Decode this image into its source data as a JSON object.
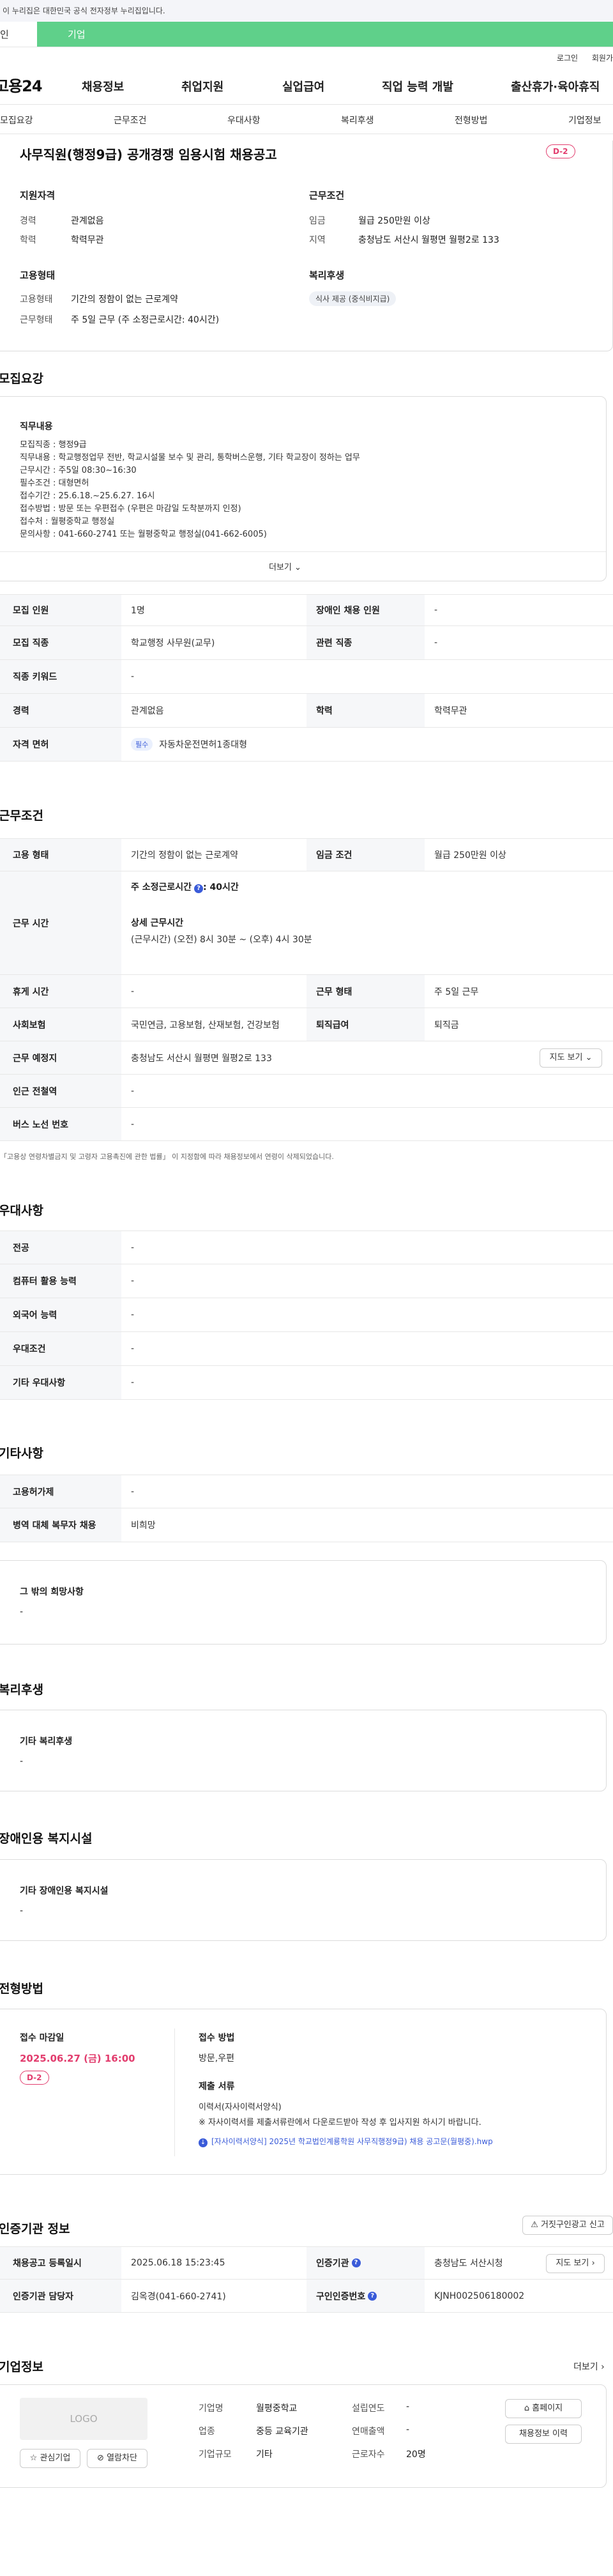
{
  "gov_notice": "이 누리집은 대한민국 공식 전자정부 누리집입니다.",
  "type_tabs": {
    "individual": "인",
    "corporate": "기업"
  },
  "util": {
    "login": "로그인",
    "signup": "회원가"
  },
  "logo": "고용24",
  "gnb": [
    "채용정보",
    "취업지원",
    "실업급여",
    "직업 능력 개발",
    "출산휴가·육아휴직"
  ],
  "section_tabs": [
    "모집요강",
    "근무조건",
    "우대사항",
    "복리후생",
    "전형방법",
    "기업정보"
  ],
  "job_title": "사무직원(행정9급) 공개경쟁 임용시험 채용공고",
  "dday": "D-2",
  "summary": {
    "qual_title": "지원자격",
    "career_label": "경력",
    "career_value": "관계없음",
    "edu_label": "학력",
    "edu_value": "학력무관",
    "work_title": "근무조건",
    "wage_label": "임금",
    "wage_value": "월급 250만원 이상",
    "area_label": "지역",
    "area_value": "충청남도 서산시 월평면 월평2로 133",
    "emp_title": "고용형태",
    "emp_type_label": "고용형태",
    "emp_type_value": "기간의 정함이 없는 근로계약",
    "work_form_label": "근무형태",
    "work_form_value": "주 5일 근무 (주 소정근로시간: 40시간)",
    "welfare_title": "복리후생",
    "welfare_chip": "식사 제공 (중식비지급)"
  },
  "recruit": {
    "title": "모집요강",
    "duty_title": "직무내용",
    "duty_lines": [
      "모집직종 : 행정9급",
      "직무내용 : 학교행정업무 전반, 학교시설물 보수 및 관리, 통학버스운행, 기타 학교장이 정하는 업무",
      "근무시간 : 주5일 08:30~16:30",
      "필수조건 : 대형면허",
      "접수기간 : 25.6.18.~25.6.27. 16시",
      "접수방법 : 방문 또는 우편접수 (우편은 마감일 도착분까지 인정)",
      "접수처 : 월평중학교 행정실",
      "문의사항 : 041-660-2741 또는 월평중학교 행정실(041-662-6005)"
    ],
    "more": "더보기",
    "rows": [
      {
        "th": "모집 인원",
        "td": "1명",
        "th2": "장애인 채용 인원",
        "td2": "-"
      },
      {
        "th": "모집 직종",
        "td": "학교행정 사무원(교무)",
        "th2": "관련 직종",
        "td2": "-"
      },
      {
        "th": "직종 키워드",
        "td": "-"
      },
      {
        "th": "경력",
        "td": "관계없음",
        "th2": "학력",
        "td2": "학력무관"
      },
      {
        "th": "자격 면허",
        "td": "자동차운전면허1종대형",
        "chip": "필수"
      }
    ]
  },
  "work": {
    "title": "근무조건",
    "rows": [
      {
        "th": "고용 형태",
        "td": "기간의 정함이 없는 근로계약",
        "th2": "임금 조건",
        "td2": "월급 250만원 이상"
      },
      {
        "th": "휴게 시간",
        "td": "-",
        "th2": "근무 형태",
        "td2": "주 5일 근무"
      },
      {
        "th": "사회보험",
        "td": "국민연금, 고용보험, 산재보험, 건강보험",
        "th2": "퇴직급여",
        "td2": "퇴직금"
      },
      {
        "th": "근무 예정지",
        "td": "충청남도 서산시 월평면 월평2로 133"
      },
      {
        "th": "인근 전철역",
        "td": "-"
      },
      {
        "th": "버스 노선 번호",
        "td": "-"
      }
    ],
    "hours_label": "근무 시간",
    "weekly_hours": "주 소정근로시간",
    "weekly_hours_value": ": 40시간",
    "detail_title": "상세 근무시간",
    "detail_value": "(근무시간) (오전) 8시 30분 ~ (오후) 4시 30분",
    "map_btn": "지도 보기",
    "note": "「고용상 연령차별금지 및 고령자 고용촉진에 관한 법률」 이 지정함에 따라 채용정보에서 연령이 삭제되었습니다."
  },
  "prefer": {
    "title": "우대사항",
    "rows": [
      {
        "th": "전공",
        "td": "-"
      },
      {
        "th": "컴퓨터 활용 능력",
        "td": "-"
      },
      {
        "th": "외국어 능력",
        "td": "-"
      },
      {
        "th": "우대조건",
        "td": "-"
      },
      {
        "th": "기타 우대사항",
        "td": "-"
      }
    ]
  },
  "etc": {
    "title": "기타사항",
    "rows": [
      {
        "th": "고용허가제",
        "td": "-"
      },
      {
        "th": "병역 대체 복무자 채용",
        "td": "비희망"
      }
    ],
    "wish_title": "그 밖의 희망사항",
    "wish_value": "-"
  },
  "welfare": {
    "title": "복리후생",
    "sub": "기타 복리후생",
    "value": "-"
  },
  "disability": {
    "title": "장애인용 복지시설",
    "sub": "기타 장애인용 복지시설",
    "value": "-"
  },
  "screening": {
    "title": "전형방법",
    "deadline_label": "접수 마감일",
    "deadline_value": "2025.06.27 (금) 16:00",
    "dday": "D-2",
    "method_label": "접수 방법",
    "method_value": "방문,우편",
    "docs_label": "제출 서류",
    "docs_line1": "이력서(자사이력서양식)",
    "docs_line2": "※ 자사이력서를 제출서류란에서 다운로드받아 작성 후 입사지원 하시기 바랍니다.",
    "file_name": "[자사이력서양식] 2025년 학교법인계룡학원 사무직행정9급) 채용 공고문(월평중).hwp"
  },
  "cert": {
    "title": "인증기관 정보",
    "report_btn": "거짓구인광고 신고",
    "rows": [
      {
        "th": "채용공고 등록일시",
        "td": "2025.06.18 15:23:45",
        "th2": "인증기관",
        "td2": "충청남도 서산시청"
      },
      {
        "th": "인증기관 담당자",
        "td": "김옥경(041-660-2741)",
        "th2": "구인인증번호",
        "td2": "KJNH002506180002"
      }
    ],
    "map_btn": "지도 보기"
  },
  "company": {
    "title": "기업정보",
    "more": "더보기",
    "logo_text": "LOGO",
    "name_label": "기업명",
    "name_value": "월평중학교",
    "year_label": "설립연도",
    "year_value": "-",
    "type_label": "업종",
    "type_value": "중등 교육기관",
    "sales_label": "연매출액",
    "sales_value": "-",
    "size_label": "기업규모",
    "size_value": "기타",
    "emp_label": "근로자수",
    "emp_value": "20명",
    "homepage_btn": "홈페이지",
    "jobs_btn": "채용정보 이력",
    "fav_btn": "관심기업",
    "block_btn": "열람차단"
  }
}
